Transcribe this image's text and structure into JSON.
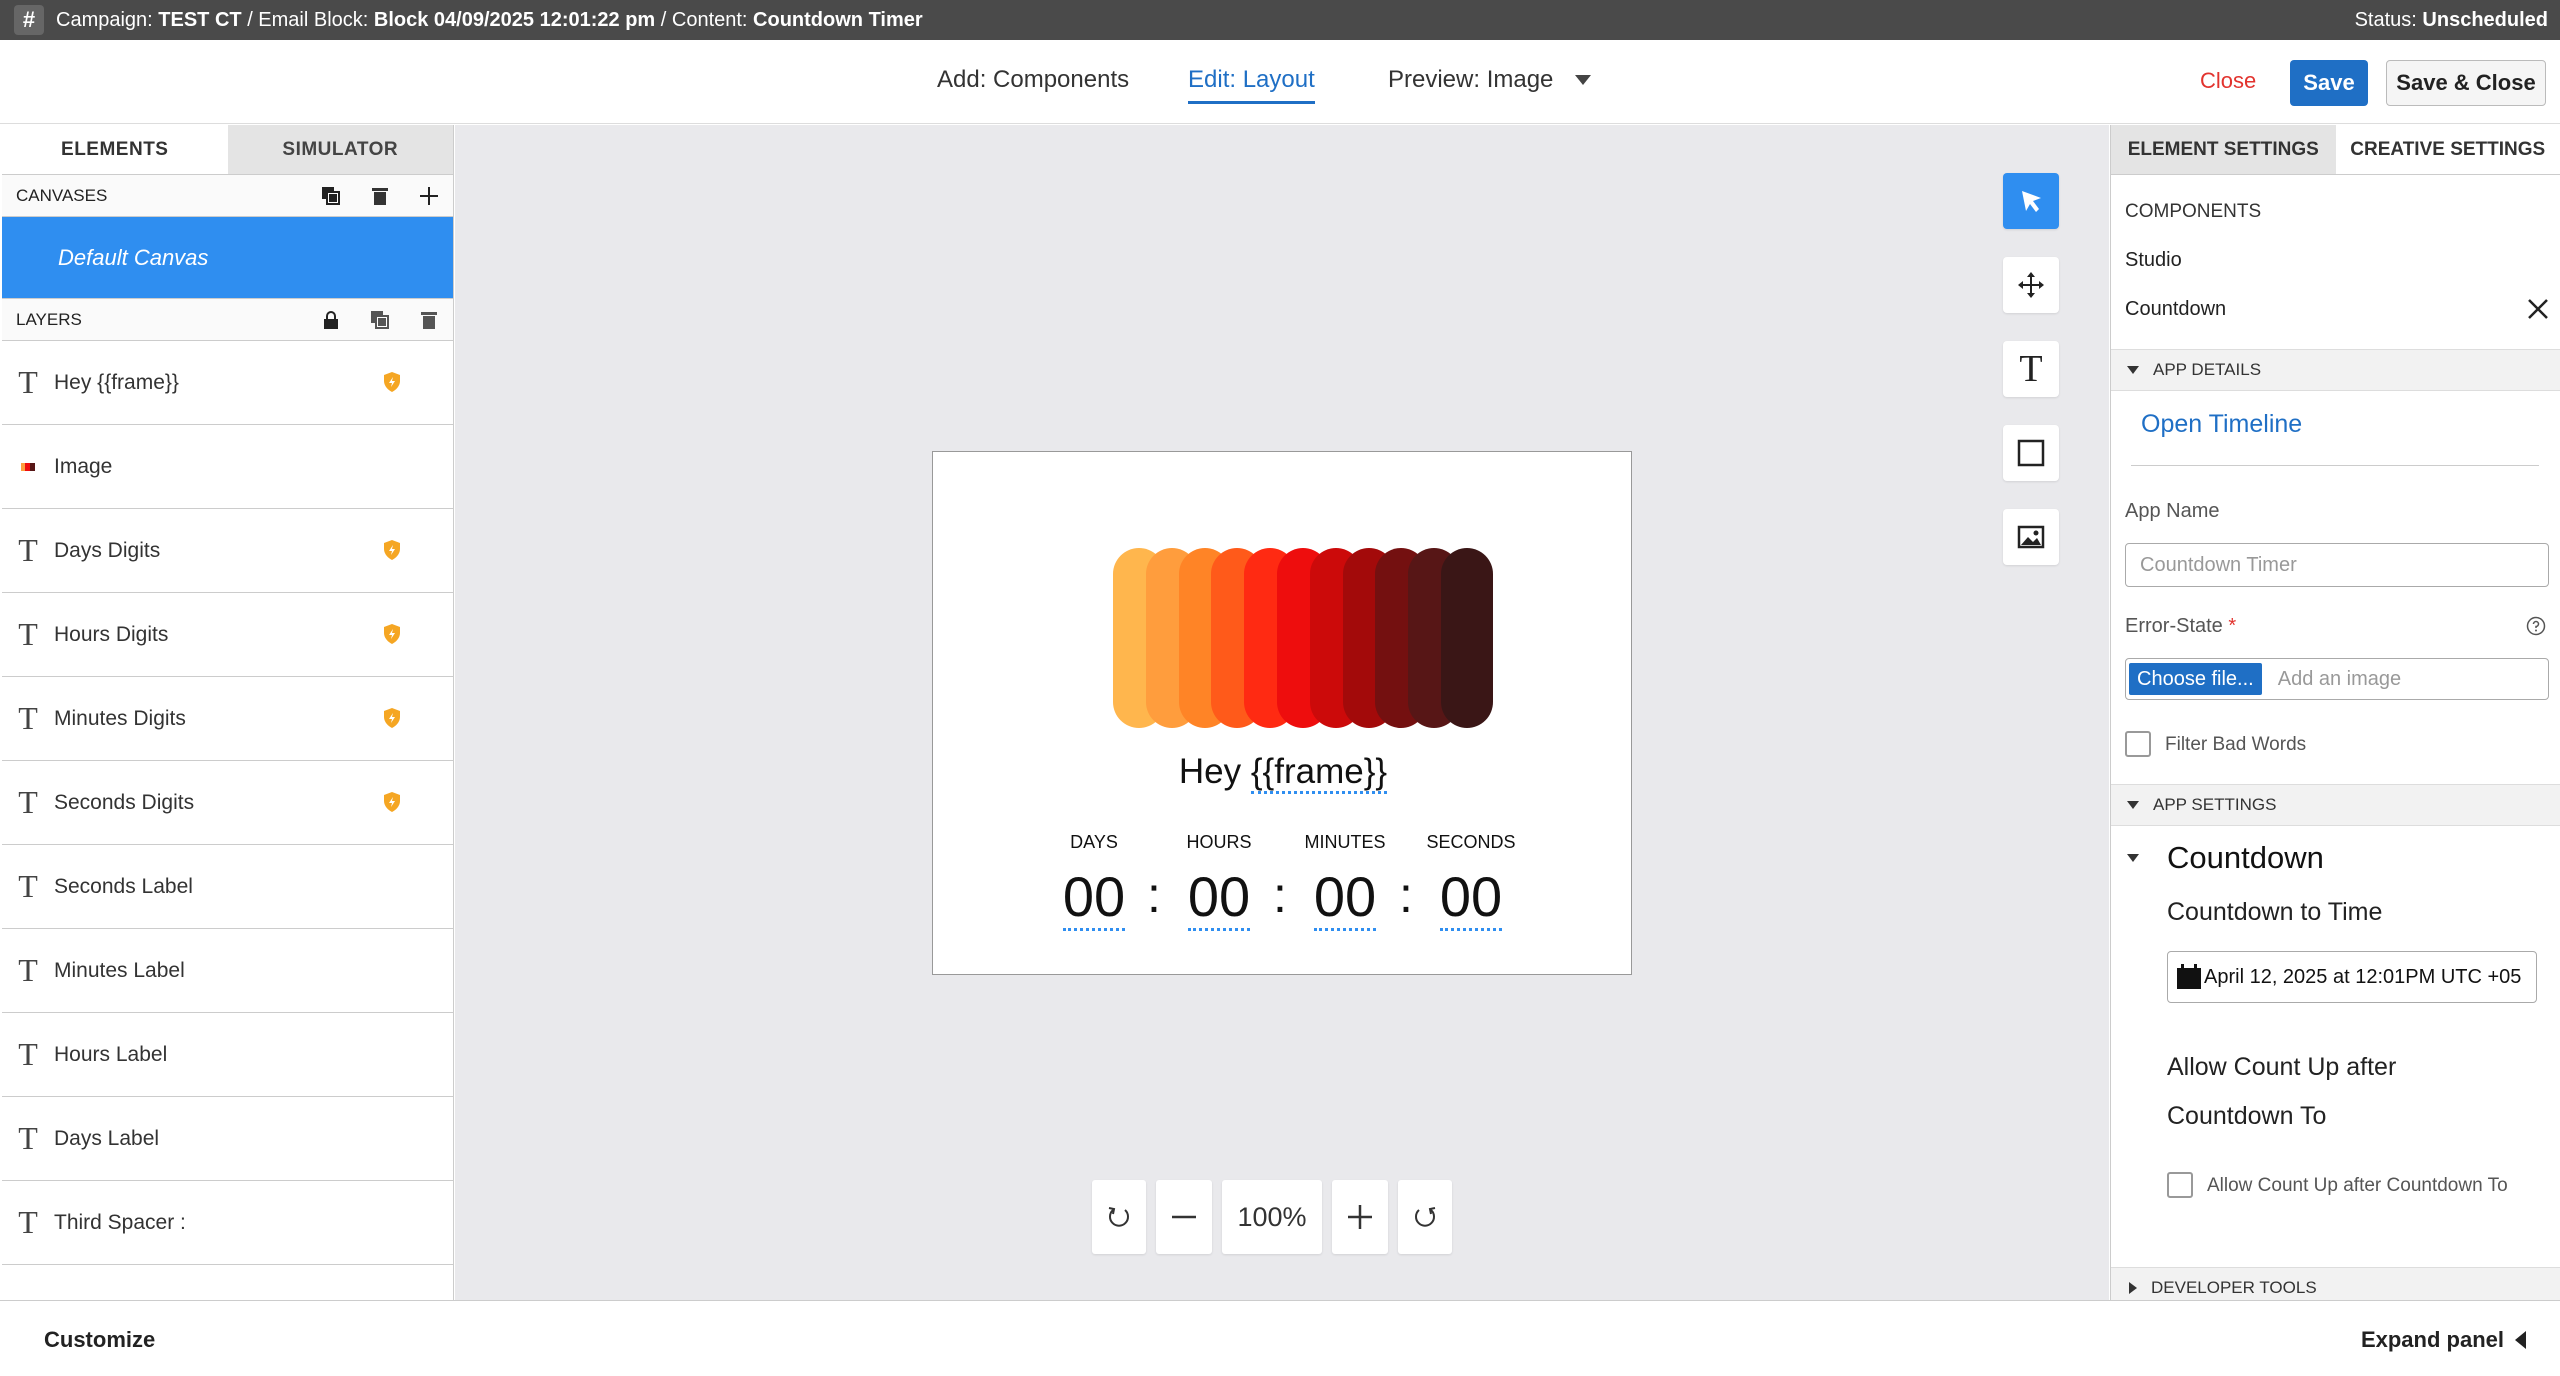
{
  "topbar": {
    "campaign_prefix": "Campaign:",
    "campaign_name": "TEST CT",
    "block_prefix": "/ Email Block:",
    "block_name": "Block 04/09/2025 12:01:22 pm",
    "content_prefix": "/ Content:",
    "content_name": "Countdown Timer",
    "status_prefix": "Status:",
    "status_value": "Unscheduled",
    "hash_icon": "#"
  },
  "header": {
    "add": "Add: Components",
    "edit": "Edit: Layout",
    "preview": "Preview: Image",
    "close": "Close",
    "save": "Save",
    "save_close": "Save & Close"
  },
  "left_panel": {
    "tabs": [
      "ELEMENTS",
      "SIMULATOR"
    ],
    "canvases_title": "CANVASES",
    "default_canvas": "Default Canvas",
    "layers_title": "LAYERS",
    "layers": [
      {
        "name": "Hey {{frame}}",
        "kind": "text",
        "shield": true
      },
      {
        "name": "Image",
        "kind": "image",
        "shield": false
      },
      {
        "name": "Days Digits",
        "kind": "text",
        "shield": true
      },
      {
        "name": "Hours Digits",
        "kind": "text",
        "shield": true
      },
      {
        "name": "Minutes Digits",
        "kind": "text",
        "shield": true
      },
      {
        "name": "Seconds Digits",
        "kind": "text",
        "shield": true
      },
      {
        "name": "Seconds Label",
        "kind": "text",
        "shield": false
      },
      {
        "name": "Minutes Label",
        "kind": "text",
        "shield": false
      },
      {
        "name": "Hours Label",
        "kind": "text",
        "shield": false
      },
      {
        "name": "Days Label",
        "kind": "text",
        "shield": false
      },
      {
        "name": "Third Spacer :",
        "kind": "text",
        "shield": false
      }
    ]
  },
  "canvas": {
    "greeting_prefix": "Hey ",
    "greeting_token": "{{frame}}",
    "labels": [
      "DAYS",
      "HOURS",
      "MINUTES",
      "SECONDS"
    ],
    "digits": [
      "00",
      "00",
      "00",
      "00"
    ],
    "colon": ":",
    "bar_colors": [
      "#ffb64d",
      "#ff9d3d",
      "#ff8426",
      "#ff5a1a",
      "#ff2a12",
      "#ee0d0d",
      "#cc0a0a",
      "#a30a0a",
      "#741010",
      "#571616",
      "#3a1616"
    ],
    "zoom": "100%"
  },
  "right_panel": {
    "tabs": [
      "ELEMENT SETTINGS",
      "CREATIVE SETTINGS"
    ],
    "components_title": "COMPONENTS",
    "studio": "Studio",
    "countdown": "Countdown",
    "app_details": "APP DETAILS",
    "open_timeline": "Open Timeline",
    "app_name_label": "App Name",
    "app_name_placeholder": "Countdown Timer",
    "error_state_label": "Error-State",
    "required_mark": "*",
    "choose_file": "Choose file...",
    "add_image_placeholder": "Add an image",
    "filter_bad_words": "Filter Bad Words",
    "app_settings": "APP SETTINGS",
    "countdown_heading": "Countdown",
    "countdown_to_time": "Countdown to Time",
    "countdown_value": "April 12, 2025 at 12:01PM UTC +05",
    "allow_count_up_line1": "Allow Count Up after",
    "allow_count_up_line2": "Countdown To",
    "allow_count_up_checkbox": "Allow Count Up after Countdown To",
    "developer_tools": "DEVELOPER TOOLS"
  },
  "bottom": {
    "customize": "Customize",
    "expand": "Expand panel"
  }
}
